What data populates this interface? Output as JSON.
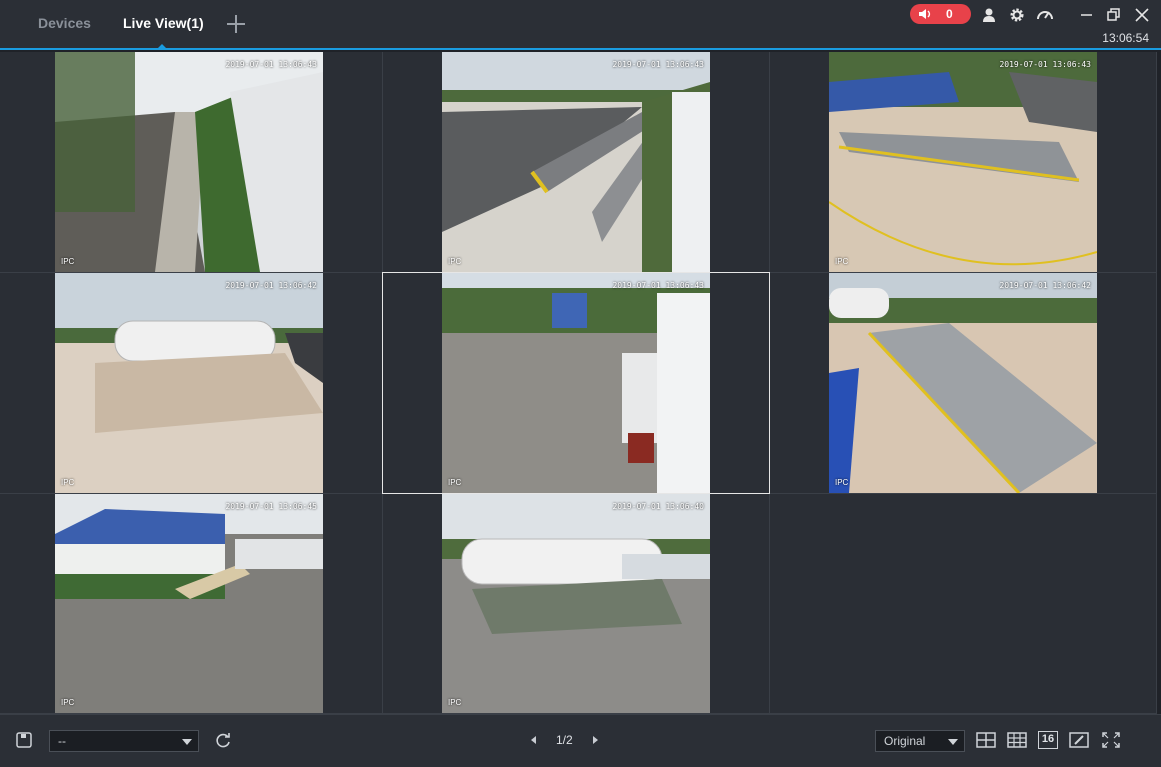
{
  "tabs": {
    "devices": "Devices",
    "live_view": "Live View(1)"
  },
  "header": {
    "alarm_count": "0",
    "clock": "13:06:54",
    "icons": [
      "speaker-icon",
      "user-icon",
      "gear-icon",
      "speedometer-icon",
      "minimize-icon",
      "restore-icon",
      "close-icon"
    ]
  },
  "colors": {
    "accent": "#1a9ce0",
    "alarm": "#e8424a",
    "selected_border": "#e6e6e6"
  },
  "cells": [
    {
      "timestamp": "2019-07-01 13:06:43",
      "label": "IPC"
    },
    {
      "timestamp": "2019-07-01 13:06:43",
      "label": "IPC"
    },
    {
      "timestamp": "2019-07-01 13:06:43",
      "label": "IPC"
    },
    {
      "timestamp": "2019-07-01 13:06:42",
      "label": "IPC"
    },
    {
      "timestamp": "2019-07-01 13:06:43",
      "label": "IPC"
    },
    {
      "timestamp": "2019-07-01 13:06:42",
      "label": "IPC"
    },
    {
      "timestamp": "2019-07-01 13:06:45",
      "label": "IPC"
    },
    {
      "timestamp": "2019-07-01 13:06:40",
      "label": "IPC"
    }
  ],
  "footer": {
    "view_select_value": "--",
    "page_indicator": "1/2",
    "stream_select_value": "Original",
    "layout_16_label": "16"
  }
}
